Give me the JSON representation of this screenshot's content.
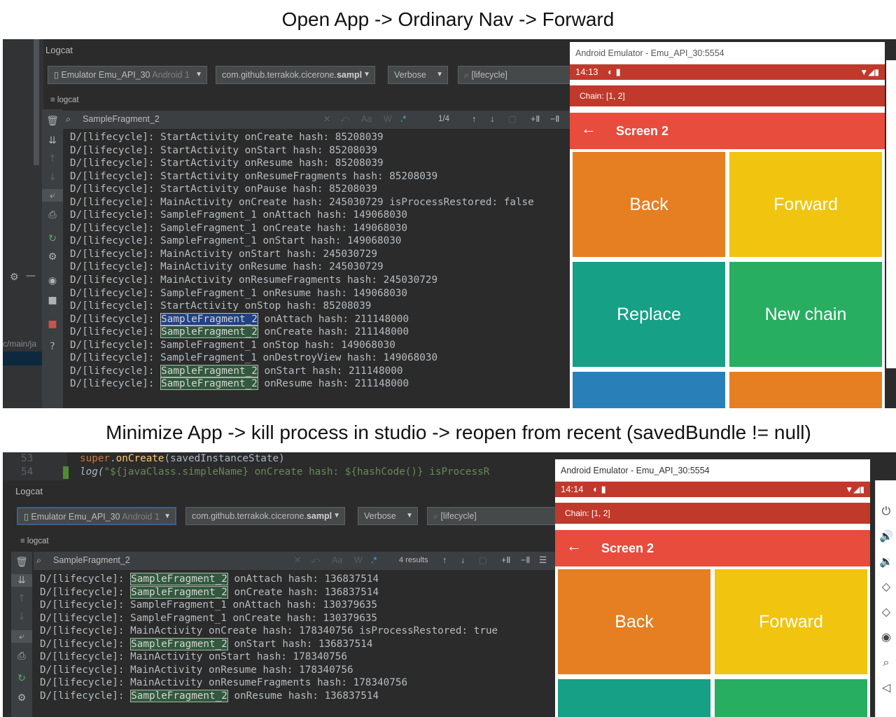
{
  "captions": {
    "top": "Open App -> Ordinary Nav -> Forward",
    "bottom": "Minimize App -> kill process in studio -> reopen from recent  (savedBundle != null)"
  },
  "panel1": {
    "tool_window_title": "Logcat",
    "device_combo": "Emulator Emu_API_30",
    "device_combo_suffix": " Android 1",
    "package_combo_prefix": "com.github.terrakok.cicerone.",
    "package_combo_bold": "sampl",
    "level_combo": "Verbose",
    "filter_value": "[lifecycle]",
    "logcat_tab": "logcat",
    "find_query": "SampleFragment_2",
    "find_result": "1/4",
    "side_path": "c/main/ja",
    "log_lines": [
      {
        "pre": "D/[lifecycle]: StartActivity onCreate hash: 85208039"
      },
      {
        "pre": "D/[lifecycle]: StartActivity onStart hash: 85208039"
      },
      {
        "pre": "D/[lifecycle]: StartActivity onResume hash: 85208039"
      },
      {
        "pre": "D/[lifecycle]: StartActivity onResumeFragments hash: 85208039"
      },
      {
        "pre": "D/[lifecycle]: StartActivity onPause hash: 85208039"
      },
      {
        "pre": "D/[lifecycle]: MainActivity onCreate hash: 245030729 isProcessRestored: false"
      },
      {
        "pre": "D/[lifecycle]: SampleFragment_1 onAttach hash: 149068030"
      },
      {
        "pre": "D/[lifecycle]: SampleFragment_1 onCreate hash: 149068030"
      },
      {
        "pre": "D/[lifecycle]: SampleFragment_1 onStart hash: 149068030"
      },
      {
        "pre": "D/[lifecycle]: MainActivity onStart hash: 245030729"
      },
      {
        "pre": "D/[lifecycle]: MainActivity onResume hash: 245030729"
      },
      {
        "pre": "D/[lifecycle]: MainActivity onResumeFragments hash: 245030729"
      },
      {
        "pre": "D/[lifecycle]: SampleFragment_1 onResume hash: 149068030"
      },
      {
        "pre": "D/[lifecycle]: StartActivity onStop hash: 85208039"
      },
      {
        "pre": "D/[lifecycle]: ",
        "hl": "SampleFragment_2",
        "sel": true,
        "post": " onAttach hash: 211148000"
      },
      {
        "pre": "D/[lifecycle]: ",
        "hl": "SampleFragment_2",
        "post": " onCreate hash: 211148000"
      },
      {
        "pre": "D/[lifecycle]: SampleFragment_1 onStop hash: 149068030"
      },
      {
        "pre": "D/[lifecycle]: SampleFragment_1 onDestroyView hash: 149068030"
      },
      {
        "pre": "D/[lifecycle]: ",
        "hl": "SampleFragment_2",
        "post": " onStart hash: 211148000"
      },
      {
        "pre": "D/[lifecycle]: ",
        "hl": "SampleFragment_2",
        "post": " onResume hash: 211148000"
      }
    ],
    "emulator": {
      "title": "Android Emulator - Emu_API_30:5554",
      "time": "14:13",
      "chain": "Chain: [1, 2]",
      "screen_title": "Screen 2",
      "buttons": [
        "Back",
        "Forward",
        "Replace",
        "New chain"
      ]
    }
  },
  "panel2": {
    "code_lines": [
      {
        "num": "53",
        "text": "super.onCreate(savedInstanceState)"
      },
      {
        "num": "54",
        "text": "log(\"${javaClass.simpleName} onCreate hash: ${hashCode()} isProcessR"
      }
    ],
    "tool_window_title": "Logcat",
    "device_combo": "Emulator Emu_API_30",
    "device_combo_suffix": " Android 1",
    "package_combo_prefix": "com.github.terrakok.cicerone.",
    "package_combo_bold": "sampl",
    "level_combo": "Verbose",
    "filter_value": "[lifecycle]",
    "logcat_tab": "logcat",
    "find_query": "SampleFragment_2",
    "find_result": "4 results",
    "log_lines": [
      {
        "pre": "D/[lifecycle]: ",
        "hl": "SampleFragment_2",
        "post": " onAttach hash: 136837514"
      },
      {
        "pre": "D/[lifecycle]: ",
        "hl": "SampleFragment_2",
        "post": " onCreate hash: 136837514"
      },
      {
        "pre": "D/[lifecycle]: SampleFragment_1 onAttach hash: 130379635"
      },
      {
        "pre": "D/[lifecycle]: SampleFragment_1 onCreate hash: 130379635"
      },
      {
        "pre": "D/[lifecycle]: MainActivity onCreate hash: 178340756 isProcessRestored: true"
      },
      {
        "pre": "D/[lifecycle]: ",
        "hl": "SampleFragment_2",
        "post": " onStart hash: 136837514"
      },
      {
        "pre": "D/[lifecycle]: MainActivity onStart hash: 178340756"
      },
      {
        "pre": "D/[lifecycle]: MainActivity onResume hash: 178340756"
      },
      {
        "pre": "D/[lifecycle]: MainActivity onResumeFragments hash: 178340756"
      },
      {
        "pre": "D/[lifecycle]: ",
        "hl": "SampleFragment_2",
        "post": " onResume hash: 136837514"
      }
    ],
    "emulator": {
      "title": "Android Emulator - Emu_API_30:5554",
      "time": "14:14",
      "chain": "Chain: [1, 2]",
      "screen_title": "Screen 2",
      "buttons": [
        "Back",
        "Forward"
      ]
    }
  },
  "colors": {
    "ide_background": "#2b2b2b",
    "status_bar": "#c0392b",
    "app_bar": "#e74c3c",
    "tile_orange": "#e67e22",
    "tile_yellow": "#f1c40f",
    "tile_teal": "#16a085",
    "tile_green": "#27ae60",
    "tile_blue": "#2980b9",
    "search_highlight": "#32593d",
    "selected_highlight": "#214283"
  }
}
